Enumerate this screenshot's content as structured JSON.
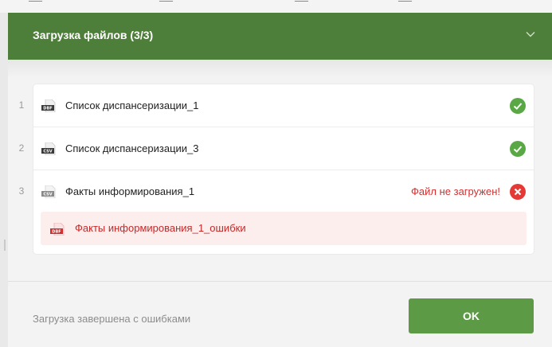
{
  "colors": {
    "header": "#4e7f3a",
    "ok_button": "#5c9a45",
    "success": "#5aa845",
    "error": "#d32f2f",
    "error_bg": "#fdeeee"
  },
  "dialog": {
    "title": "Загрузка файлов (3/3)",
    "collapse_icon": "chevron-down-icon"
  },
  "files": [
    {
      "index": "1",
      "type": "DBF",
      "name": "Список диспансеризации_1",
      "status": "ok",
      "status_icon": "check-circle-icon"
    },
    {
      "index": "2",
      "type": "CSV",
      "name": "Список диспансеризации_3",
      "status": "ok",
      "status_icon": "check-circle-icon"
    },
    {
      "index": "3",
      "type": "CSV",
      "name": "Факты информирования_1",
      "status": "error",
      "status_icon": "error-circle-icon",
      "error_text": "Файл не загружен!"
    }
  ],
  "error_file": {
    "type": "DBF",
    "name": "Факты информирования_1_ошибки"
  },
  "footer": {
    "status_text": "Загрузка завершена с ошибками",
    "ok_label": "OK"
  }
}
